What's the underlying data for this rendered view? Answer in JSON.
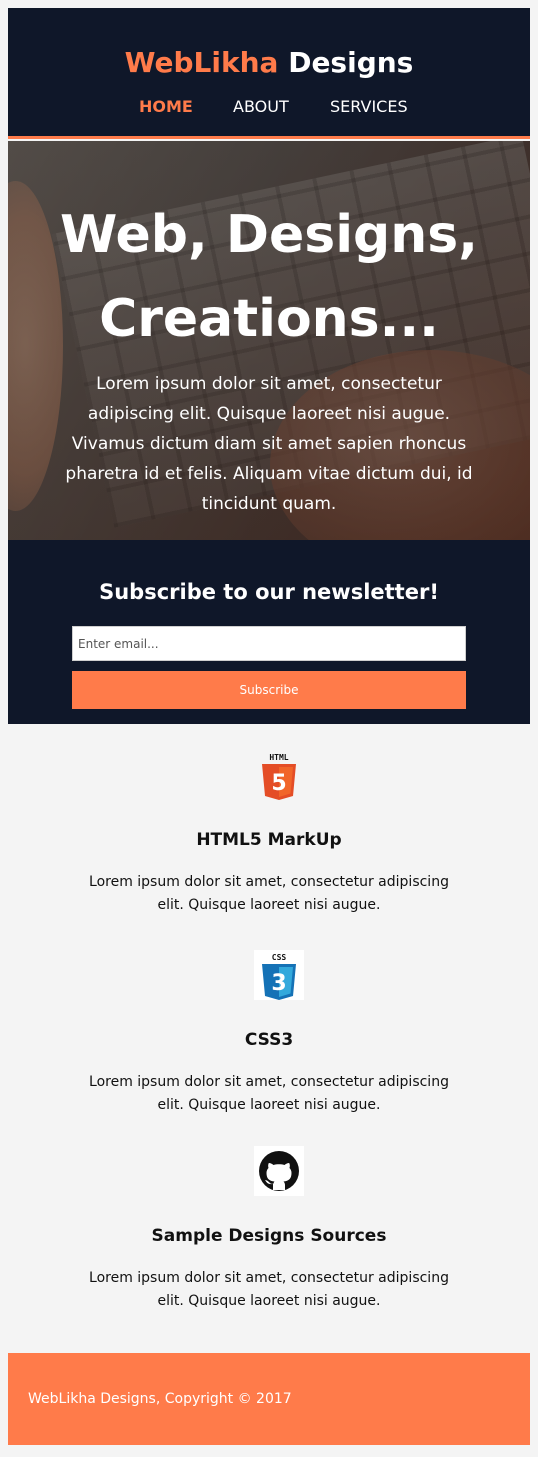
{
  "header": {
    "brand_accent": "WebLikha",
    "brand_rest": "Designs",
    "nav": [
      {
        "label": "HOME",
        "current": true
      },
      {
        "label": "ABOUT",
        "current": false
      },
      {
        "label": "SERVICES",
        "current": false
      }
    ]
  },
  "hero": {
    "title_line1": "Web, Designs,",
    "title_line2": "Creations...",
    "text": "Lorem ipsum dolor sit amet, consectetur adipiscing elit. Quisque laoreet nisi augue. Vivamus dictum diam sit amet sapien rhoncus pharetra id et felis. Aliquam vitae dictum dui, id tincidunt quam."
  },
  "newsletter": {
    "title": "Subscribe to our newsletter!",
    "email_placeholder": "Enter email...",
    "email_value": "",
    "button_label": "Subscribe"
  },
  "features": [
    {
      "icon": "html5-icon",
      "badge": "HTML",
      "number": "5",
      "title": "HTML5 MarkUp",
      "text": "Lorem ipsum dolor sit amet, consectetur adipiscing elit. Quisque laoreet nisi augue."
    },
    {
      "icon": "css3-icon",
      "badge": "CSS",
      "number": "3",
      "title": "CSS3",
      "text": "Lorem ipsum dolor sit amet, consectetur adipiscing elit. Quisque laoreet nisi augue."
    },
    {
      "icon": "github-icon",
      "title": "Sample Designs Sources",
      "text": "Lorem ipsum dolor sit amet, consectetur adipiscing elit. Quisque laoreet nisi augue."
    }
  ],
  "footer": {
    "text": "WebLikha Designs, Copyright © 2017"
  },
  "colors": {
    "accent": "#ff7b4a",
    "dark": "#0f1729",
    "background": "#f4f4f4",
    "html5_orange": "#e44d26",
    "css3_blue": "#1572b6"
  }
}
